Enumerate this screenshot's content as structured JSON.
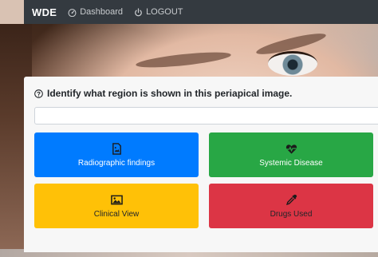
{
  "navbar": {
    "brand": "WDE",
    "links": [
      {
        "label": "Dashboard",
        "icon": "dashboard-icon"
      },
      {
        "label": "LOGOUT",
        "icon": "power-icon"
      }
    ]
  },
  "quiz": {
    "question": "Identify what region is shown in this periapical image.",
    "question_icon": "question-circle-icon",
    "answer_value": "",
    "options": [
      {
        "label": "Radiographic findings",
        "icon": "image-file-icon",
        "color": "#007bff"
      },
      {
        "label": "Systemic Disease",
        "icon": "heartbeat-icon",
        "color": "#28a745"
      },
      {
        "label": "Clinical View",
        "icon": "image-icon",
        "color": "#ffc107"
      },
      {
        "label": "Drugs Used",
        "icon": "eyedropper-icon",
        "color": "#dc3545"
      }
    ]
  },
  "colors": {
    "navbar_bg": "#343a40",
    "card_bg": "#f7f7f7"
  }
}
